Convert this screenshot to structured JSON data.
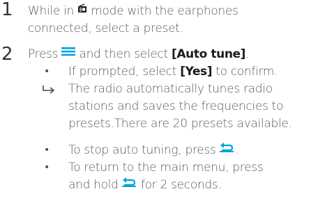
{
  "steps": [
    {
      "number": "1",
      "line1_pre": "While in ",
      "mode_icon": "radio-mode-icon",
      "line1_post": " mode with the earphones",
      "line2": "connected, select a preset."
    },
    {
      "number": "2",
      "line1_pre": "Press ",
      "menu_icon": "menu-icon",
      "line1_mid": " and then select ",
      "line1_bold": "[Auto tune]",
      "line1_post": ".",
      "accent_color": "#00a0e0"
    }
  ],
  "sub": {
    "bullet1_pre": "If prompted, select ",
    "bullet1_bold": "[Yes]",
    "bullet1_post": " to confirm.",
    "result_l1": "The radio automatically tunes radio",
    "result_l2": "stations and saves the frequencies to",
    "result_l3": "presets.There are 20 presets available.",
    "bullet2_pre": "To stop auto tuning, press ",
    "bullet2_icon": "back-icon",
    "bullet2_post": ".",
    "bullet3_l1": "To return to the main menu, press",
    "bullet3_l2_pre": "and hold ",
    "bullet3_icon": "back-icon",
    "bullet3_l2_post": " for 2 seconds."
  },
  "glyphs": {
    "bullet": "•",
    "arrow": "↳"
  }
}
